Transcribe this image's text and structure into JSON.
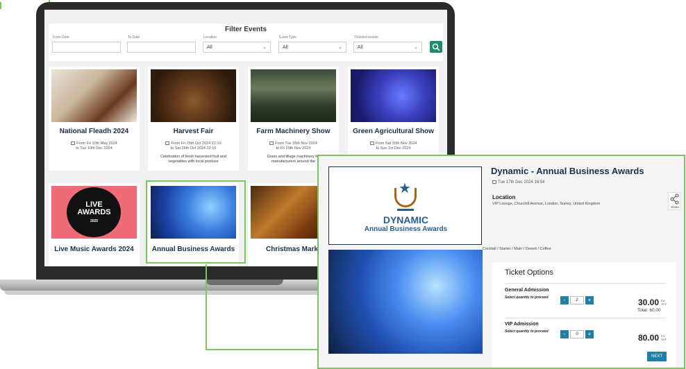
{
  "filter": {
    "title": "Filter Events",
    "from_date_label": "From Date",
    "to_date_label": "To Date",
    "location_label": "Location",
    "location_value": "All",
    "event_type_label": "Event Type",
    "event_type_value": "All",
    "ticketed_label": "Ticketed events",
    "ticketed_value": "All"
  },
  "events": [
    {
      "title": "National Fleadh 2024",
      "date_line1": "From Fri 10th May 2024",
      "date_line2": "to Tue 10th Dec 2024",
      "desc_line1": "",
      "desc_line2": ""
    },
    {
      "title": "Harvest Fair",
      "date_line1": "From Fri 25th Oct 2024 22:10",
      "date_line2": "to Sat 26th Oct 2024 22:10",
      "desc_line1": "Celebration of fresh harvested fruit and",
      "desc_line2": "vegetables with local produce"
    },
    {
      "title": "Farm Machinery Show",
      "date_line1": "From Tue 26th Nov 2024",
      "date_line2": "to Fri 29th Nov 2024",
      "desc_line1": "Grass and tillage machinery fro",
      "desc_line2": "manufacturers around the"
    },
    {
      "title": "Green Agricultural Show",
      "date_line1": "From Sat 30th Nov 2024",
      "date_line2": "to Sun 1st Dec 2024",
      "desc_line1": "",
      "desc_line2": ""
    },
    {
      "title": "Live Music Awards 2024",
      "logo_line1": "LIVE",
      "logo_line2": "AWARDS",
      "logo_line3": "2025"
    },
    {
      "title": "Annual Business Awards"
    },
    {
      "title": "Christmas Mark"
    }
  ],
  "detail": {
    "logo_line1": "DYNAMIC",
    "logo_line2": "Annual Business Awards",
    "title": "Dynamic - Annual Business Awards",
    "date": "Tue 17th Dec 2024 16:54",
    "location_heading": "Location",
    "location_value": "VIP Lounge, Churchill Avenue, London, Surrey, United Kingdom",
    "share_label": "Share",
    "menu": "Cocktail / Starter / Main / Desert / Coffee",
    "tickets_heading": "Ticket Options",
    "select_hint": "Select quantity to proceed",
    "tickets": [
      {
        "name": "General Admission",
        "qty": "2",
        "price": "30.00",
        "price_suffix1": "Inc",
        "price_suffix2": "VAT",
        "total": "Total:  60.00"
      },
      {
        "name": "VIP Admission",
        "qty": "0",
        "price": "80.00",
        "price_suffix1": "Inc",
        "price_suffix2": "VAT"
      }
    ],
    "next_label": "NEXT"
  }
}
